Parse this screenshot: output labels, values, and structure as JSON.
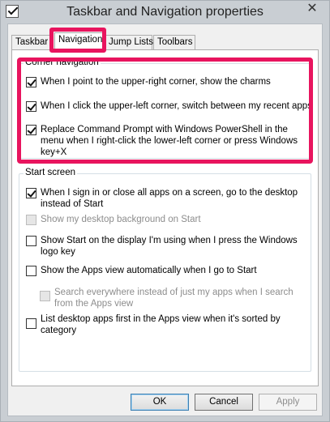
{
  "window": {
    "title": "Taskbar and Navigation properties",
    "close_glyph": "✕"
  },
  "tabs": [
    {
      "label": "Taskbar"
    },
    {
      "label": "Navigation"
    },
    {
      "label": "Jump Lists"
    },
    {
      "label": "Toolbars"
    }
  ],
  "active_tab": "Navigation",
  "highlight_color": "#e8145e",
  "corner_navigation": {
    "legend": "Corner navigation",
    "options": [
      {
        "label": "When I point to the upper-right corner, show the charms",
        "checked": true
      },
      {
        "label": "When I click the upper-left corner, switch between my recent apps",
        "checked": true
      },
      {
        "label": "Replace Command Prompt with Windows PowerShell in the menu when I right-click the lower-left corner or press Windows key+X",
        "checked": true
      }
    ]
  },
  "start_screen": {
    "legend": "Start screen",
    "options": [
      {
        "label": "When I sign in or close all apps on a screen, go to the desktop instead of Start",
        "checked": true,
        "enabled": true
      },
      {
        "label": "Show my desktop background on Start",
        "checked": false,
        "enabled": false
      },
      {
        "label": "Show Start on the display I'm using when I press the Windows logo key",
        "checked": false,
        "enabled": true
      },
      {
        "label": "Show the Apps view automatically when I go to Start",
        "checked": false,
        "enabled": true
      },
      {
        "label": "Search everywhere instead of just my apps when I search from the Apps view",
        "checked": false,
        "enabled": false
      },
      {
        "label": "List desktop apps first in the Apps view when it's sorted by category",
        "checked": false,
        "enabled": true
      }
    ]
  },
  "buttons": {
    "ok": "OK",
    "cancel": "Cancel",
    "apply": "Apply"
  }
}
